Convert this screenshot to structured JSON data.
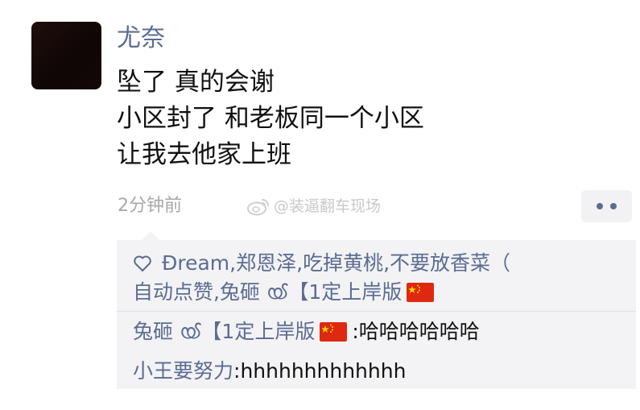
{
  "post": {
    "username": "尤奈",
    "lines": [
      "坠了 真的会谢",
      "小区封了 和老板同一个小区",
      "让我去他家上班"
    ],
    "time": "2分钟前",
    "watermark": "@装逼翻车现场"
  },
  "likes": {
    "line1": [
      "Ðream",
      "郑恩泽",
      "吃掉黄桃",
      "不要放香菜（"
    ],
    "line2_a": "自动点赞",
    "line2_b": "兔砸 ൕ【1定上岸版",
    "separator": ", "
  },
  "comments": [
    {
      "author": "兔砸 ൕ【1定上岸版",
      "colon": ": ",
      "text": "哈哈哈哈哈哈"
    },
    {
      "author": "小王要努力",
      "colon": ": ",
      "text": "hhhhhhhhhhhhh"
    }
  ],
  "colors": {
    "link": "#5b6b92",
    "flag_red": "#de2910",
    "flag_star": "#ffde00"
  }
}
